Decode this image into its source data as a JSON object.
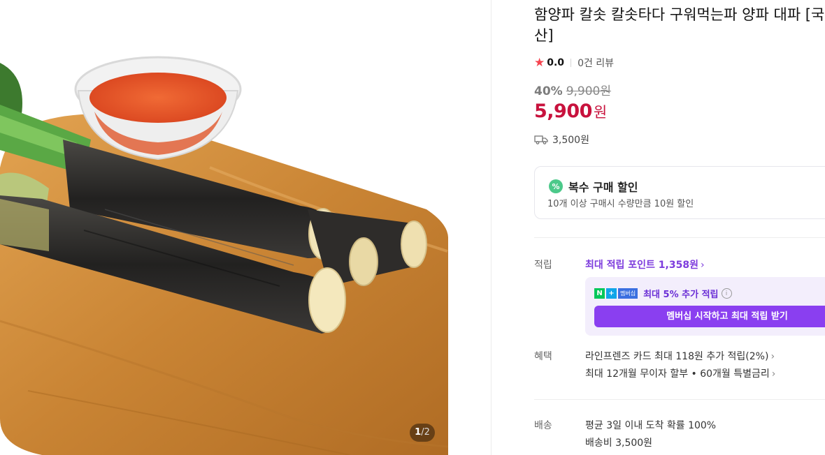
{
  "gallery": {
    "current_page": "1",
    "total_pages": "/2"
  },
  "product": {
    "title": "함양파 칼솟 칼솟타다 구워먹는파 양파 대파 [국내산]",
    "rating_score": "0.0",
    "review_count": "0건 리뷰",
    "discount_percent": "40%",
    "original_price": "9,900원",
    "sale_price": "5,900",
    "price_unit": "원",
    "shipping_fee": "3,500원"
  },
  "bulk_discount": {
    "title": "복수 구매 할인",
    "description": "10개 이상 구매시 수량만큼 10원 할인"
  },
  "points": {
    "label": "적립",
    "max_point_text": "최대 적립 포인트",
    "max_point_value": "1,358원",
    "membership_line": "최대 5% 추가 적립",
    "membership_badge": "멤버십",
    "membership_button": "멤버십 시작하고 최대 적립 받기"
  },
  "benefits": {
    "label": "혜택",
    "line1": "라인프렌즈 카드 최대 118원 추가 적립(2%)",
    "line2": "최대 12개월 무이자 할부 • 60개월 특별금리"
  },
  "delivery": {
    "label": "배송",
    "line1": "평균 3일 이내 도착 확률 100%",
    "line2": "배송비 3,500원"
  },
  "colors": {
    "sale_red": "#c8123d",
    "purple": "#7d3cdd",
    "button_purple": "#8a3ff0",
    "naver_green": "#03c75a"
  }
}
